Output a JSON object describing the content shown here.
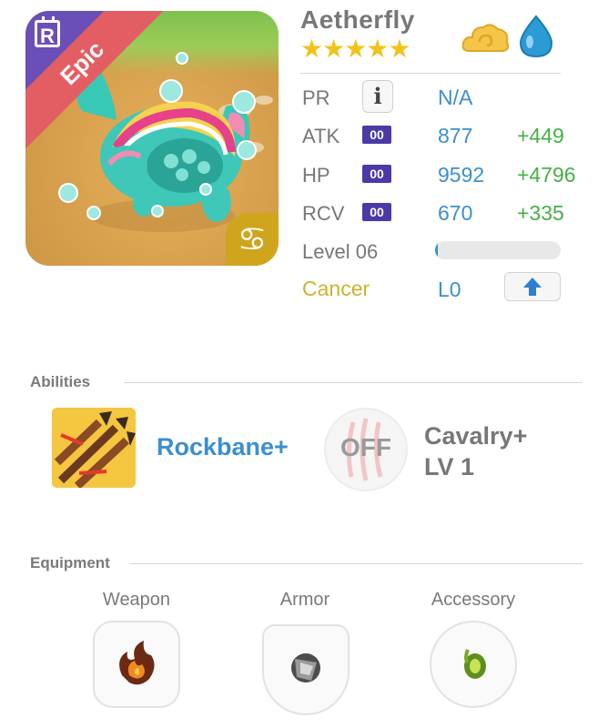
{
  "card": {
    "rarity": "Epic",
    "rarity_badge": "R",
    "sign_symbol": "♋",
    "element_icons": [
      "cloud-icon",
      "water-drop-icon"
    ]
  },
  "header": {
    "name": "Aetherfly",
    "stars": "★★★★★",
    "star_count": 5
  },
  "stats": {
    "pr": {
      "label": "PR",
      "value": "N/A"
    },
    "atk": {
      "label": "ATK",
      "badge": "00",
      "value": "877",
      "bonus": "+449"
    },
    "hp": {
      "label": "HP",
      "badge": "00",
      "value": "9592",
      "bonus": "+4796"
    },
    "rcv": {
      "label": "RCV",
      "badge": "00",
      "value": "670",
      "bonus": "+335"
    },
    "level": {
      "label": "Level 06",
      "progress_fraction": 0.02
    },
    "sign": {
      "label": "Cancer",
      "value": "L0"
    }
  },
  "abilities": {
    "title": "Abilities",
    "items": [
      {
        "name": "Rockbane+",
        "icon": "arrows-icon"
      },
      {
        "status": "OFF",
        "name_line1": "Cavalry+",
        "name_line2": "LV 1",
        "icon": "claw-icon"
      }
    ]
  },
  "equipment": {
    "title": "Equipment",
    "slots": [
      {
        "label": "Weapon",
        "icon": "fire-weapon-icon"
      },
      {
        "label": "Armor",
        "icon": "metal-armor-icon"
      },
      {
        "label": "Accessory",
        "icon": "leaf-accessory-icon"
      }
    ]
  },
  "colors": {
    "accent_blue": "#3b8fcf",
    "bonus_green": "#45b044",
    "epic_red": "#e35e63",
    "rare_purple": "#6a4fb8",
    "star_gold": "#f0c419",
    "cancer_gold": "#cfb22e"
  }
}
